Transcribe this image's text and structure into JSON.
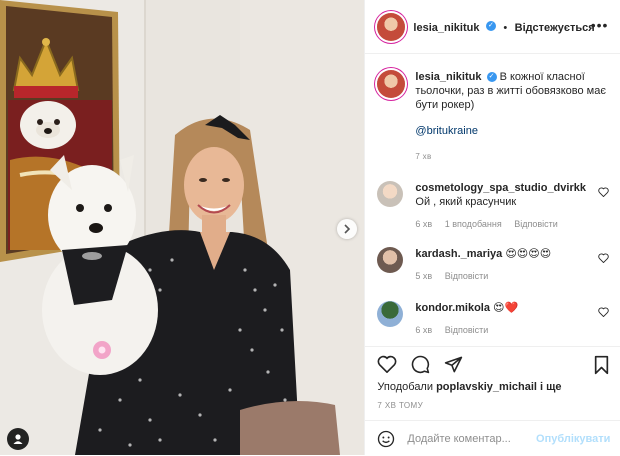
{
  "post": {
    "author": "lesia_nikituk",
    "follow_separator": "•",
    "follow_label": "Відстежується",
    "more_icon": "more-icon",
    "colors": {
      "verified": "#3897f0",
      "link": "#00376b",
      "muted": "#8e8e8e",
      "heart_red": "#ed4956"
    }
  },
  "caption": {
    "author": "lesia_nikituk",
    "text": "В кожної класної тьолочки, раз в житті обовязково має бути рокер)",
    "mention": "@britukraine",
    "time": "7 хв"
  },
  "comments": [
    {
      "author": "cosmetology_spa_studio_dvirkk",
      "text": "Ой , який красунчик",
      "time": "6 хв",
      "likes": "1 вподобання",
      "reply": "Відповісти"
    },
    {
      "author": "kardash._mariya",
      "text": "😍😍😍😍",
      "time": "5 хв",
      "reply": "Відповісти"
    },
    {
      "author": "kondor.mikola",
      "text": "😍❤️",
      "time": "6 хв",
      "reply": "Відповісти"
    }
  ],
  "actions": {
    "liked_by_prefix": "Уподобали",
    "liked_by_user": "poplavskiy_michail",
    "liked_by_suffix": "і ще",
    "time_ago": "7 ХВ ТОМУ"
  },
  "composer": {
    "placeholder": "Додайте коментар...",
    "publish_label": "Опублікувати"
  }
}
